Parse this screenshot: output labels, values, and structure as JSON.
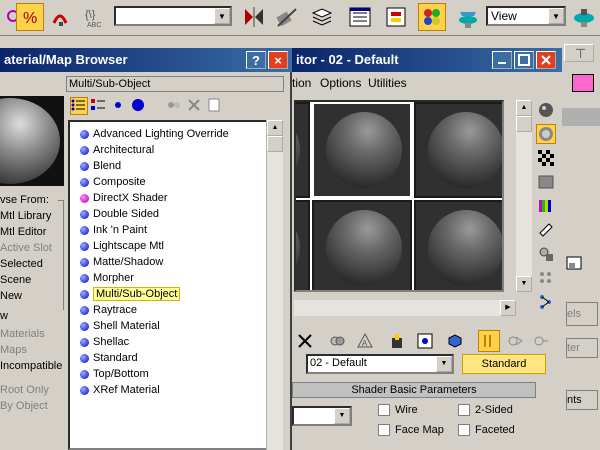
{
  "toolbar": {
    "view_select_value": "View"
  },
  "browser": {
    "title": "aterial/Map Browser",
    "help_label": "?",
    "close_label": "×",
    "current_path": "Multi/Sub-Object",
    "browse_from_label": "vse From:",
    "browse_from": [
      "Mtl Library",
      "Mtl Editor",
      "Active Slot",
      "Selected",
      "Scene",
      "New"
    ],
    "show_label": "w",
    "show_options": [
      "Materials",
      "Maps",
      "Incompatible"
    ],
    "extra_options": [
      "Root Only",
      "By Object"
    ],
    "list_items": [
      {
        "label": "Advanced Lighting Override",
        "color": "blue"
      },
      {
        "label": "Architectural",
        "color": "blue"
      },
      {
        "label": "Blend",
        "color": "blue"
      },
      {
        "label": "Composite",
        "color": "blue"
      },
      {
        "label": "DirectX Shader",
        "color": "magenta"
      },
      {
        "label": "Double Sided",
        "color": "blue"
      },
      {
        "label": "Ink 'n Paint",
        "color": "blue"
      },
      {
        "label": "Lightscape Mtl",
        "color": "blue"
      },
      {
        "label": "Matte/Shadow",
        "color": "blue"
      },
      {
        "label": "Morpher",
        "color": "blue"
      },
      {
        "label": "Multi/Sub-Object",
        "color": "blue",
        "selected": true
      },
      {
        "label": "Raytrace",
        "color": "blue"
      },
      {
        "label": "Shell Material",
        "color": "blue"
      },
      {
        "label": "Shellac",
        "color": "blue"
      },
      {
        "label": "Standard",
        "color": "blue"
      },
      {
        "label": "Top/Bottom",
        "color": "blue"
      },
      {
        "label": "XRef Material",
        "color": "blue"
      }
    ]
  },
  "editor": {
    "title": "itor - 02 - Default",
    "menu": [
      "tion",
      "Options",
      "Utilities"
    ],
    "material_name": "02 - Default",
    "type_button": "Standard",
    "rollout_title": "Shader Basic Parameters",
    "checkboxes": [
      "Wire",
      "2-Sided",
      "Face Map",
      "Faceted"
    ]
  },
  "right_panel": {
    "labels": [
      "els",
      "ter",
      "nts"
    ]
  }
}
